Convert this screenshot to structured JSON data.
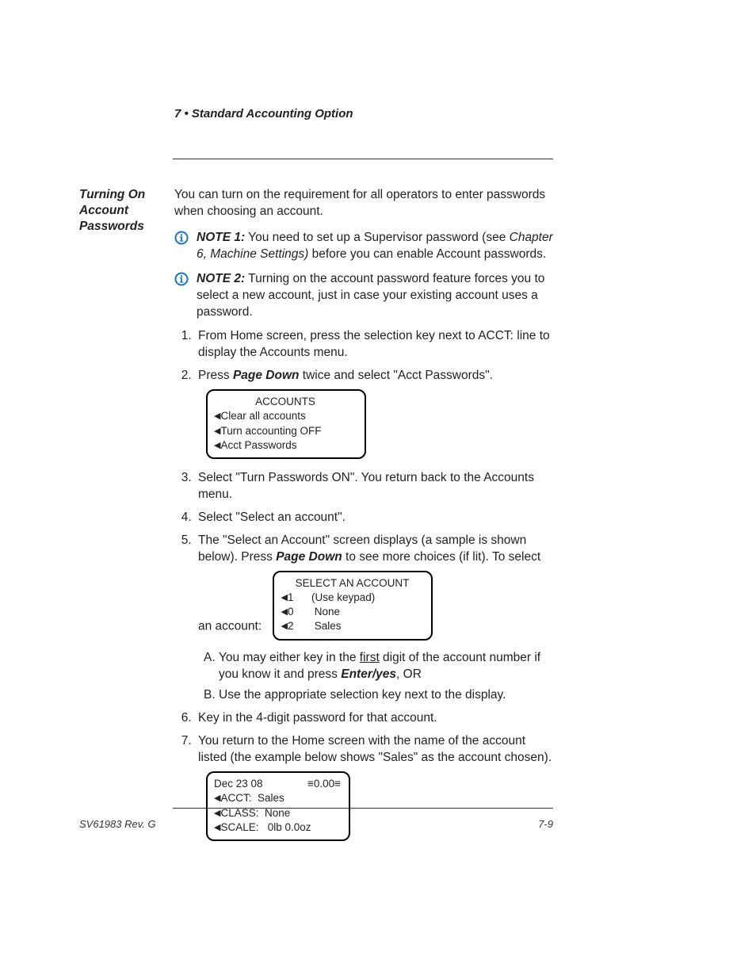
{
  "running_head": {
    "chapter": "7 • Standard Accounting Option",
    "title": ""
  },
  "side_heading": "Turning On Account Passwords",
  "intro": "You can turn on the requirement for all operators to enter passwords when choosing an account.",
  "notes": [
    {
      "label": "NOTE 1:",
      "before_italic": " You need to set up a Supervisor password (see ",
      "italic_ref": "Chapter 6, Machine Settings)",
      "after_italic": " before you can enable Account passwords."
    },
    {
      "label": "NOTE 2:",
      "plain": " Turning on the account password feature forces you to select a new account, just in case your existing account uses a password."
    }
  ],
  "steps": {
    "s1": "From Home screen, press the selection key next to ACCT: line to display the Accounts menu.",
    "s2_a": "Press ",
    "s2_b": "Page Down",
    "s2_c": " twice and select \"Acct Passwords\".",
    "s3": "Select \"Turn Passwords ON\". You return back to the Accounts menu.",
    "s4": "Select \"Select an account\".",
    "s5_a": "The \"Select an Account\" screen displays (a sample is shown below). Press ",
    "s5_b": "Page Down",
    "s5_c": " to see more choices (if lit). To select an account:",
    "sub_a_1": "You may either key in the ",
    "sub_a_first": "first",
    "sub_a_2": " digit of the account number if you know it and press ",
    "sub_a_enter": "Enter/yes",
    "sub_a_3": ", OR",
    "sub_b": "Use the appropriate selection key next to the display.",
    "s6": "Key in the 4-digit password for that account.",
    "s7": "You return to the Home screen with the name of the account listed (the example below shows \"Sales\" as the account chosen)."
  },
  "screens": {
    "accounts": {
      "title": "ACCOUNTS",
      "l1": "Clear all accounts",
      "l2": "Turn accounting OFF",
      "l3": "Acct Passwords"
    },
    "select": {
      "title": "SELECT AN ACCOUNT",
      "l1_num": "1",
      "l1_txt": "(Use keypad)",
      "l2_num": "0",
      "l2_txt": "None",
      "l3_num": "2",
      "l3_txt": "Sales"
    },
    "home": {
      "date": "Dec  23 08",
      "amount": "≡0.00≡",
      "l1": "ACCT:  Sales",
      "l2": "CLASS:  None",
      "l3": "SCALE:   0lb 0.0oz"
    }
  },
  "footer": {
    "left": "SV61983 Rev. G",
    "right": "7-9"
  }
}
